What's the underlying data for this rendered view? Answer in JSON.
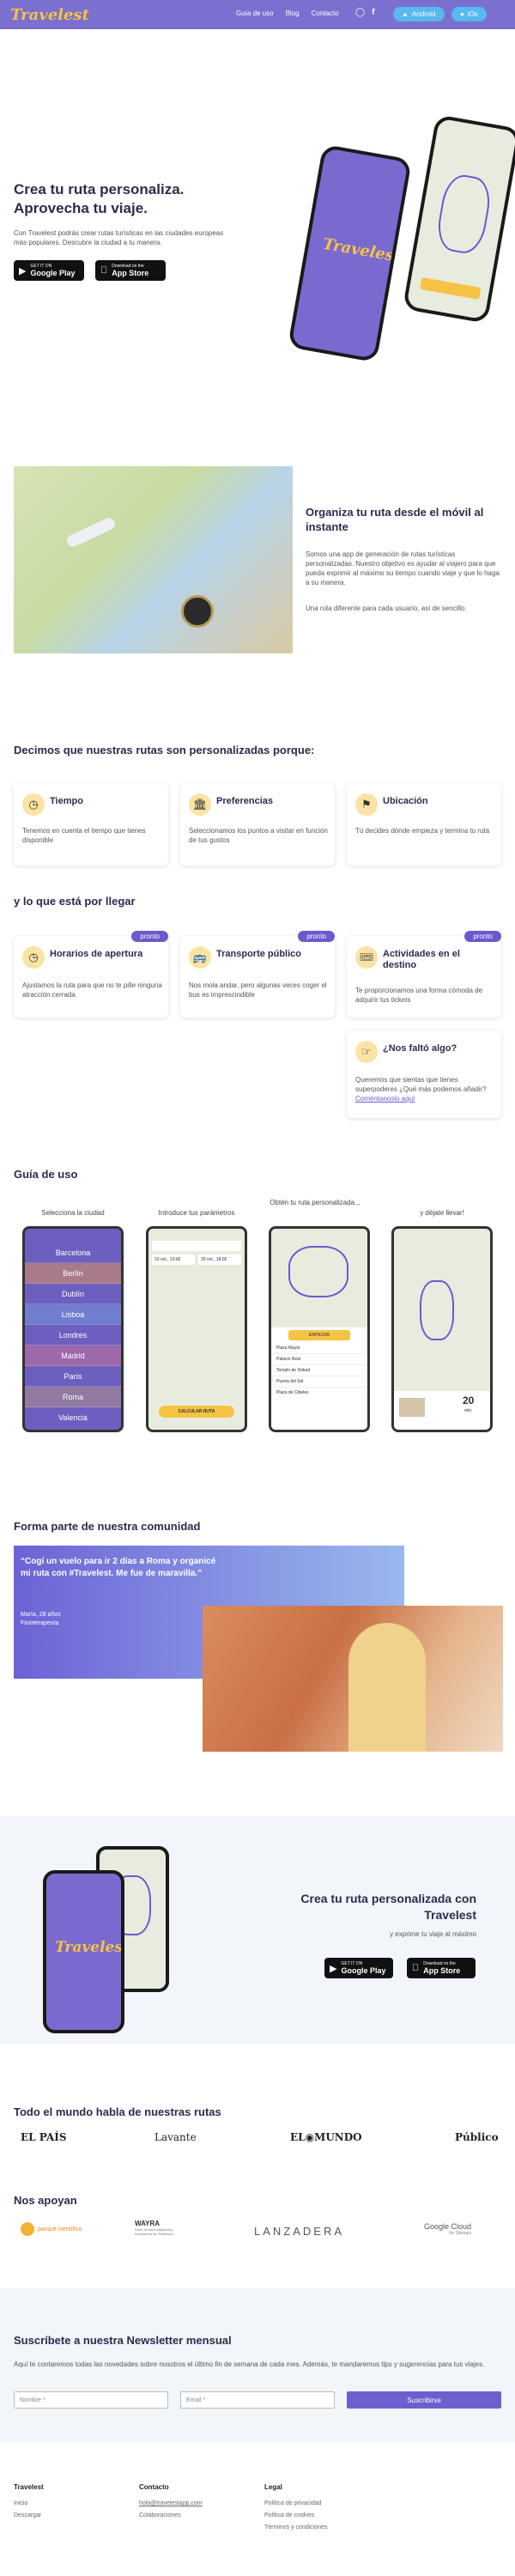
{
  "nav": {
    "logo": "Travelest",
    "links": [
      "Guía de uso",
      "Blog",
      "Contacto"
    ],
    "android": "Android",
    "ios": "iOs"
  },
  "hero": {
    "title": "Crea tu ruta personaliza. Aprovecha tu viaje.",
    "description": "Con Travelest podrás crear rutas turísticas en las ciudades europeas más populares. Descubre la ciudad a tu manera.",
    "google_small": "GET IT ON",
    "google_big": "Google Play",
    "apple_small": "Download on the",
    "apple_big": "App Store",
    "phone_logo": "Travelest"
  },
  "organize": {
    "title": "Organiza tu ruta desde el móvil al instante",
    "p1": "Somos una app de generación de rutas turísticas personalizadas. Nuestro objetivo es ayudar al viajero para que pueda exprimir al máximo su tiempo cuando viaje y que lo haga a su manera.",
    "p2": "Una ruta diferente para cada usuario, así de sencillo."
  },
  "features": {
    "title": "Decimos que nuestras rutas son personalizadas porque:",
    "cards": [
      {
        "title": "Tiempo",
        "text": "Tenemos en cuenta el tiempo que tienes disponible"
      },
      {
        "title": "Preferencias",
        "text": "Seleccionamos los puntos a visitar en función de tus gustos"
      },
      {
        "title": "Ubicación",
        "text": "Tú decides dónde empieza y termina tu ruta"
      }
    ]
  },
  "upcoming": {
    "title": "y lo que está por llegar",
    "badge": "pronto",
    "cards": [
      {
        "title": "Horarios de apertura",
        "text": "Ajustamos la ruta para que no te pille ninguna atracción cerrada"
      },
      {
        "title": "Transporte público",
        "text": "Nos mola andar, pero algunas veces coger el bus es imprescindible"
      },
      {
        "title": "Actividades en el destino",
        "text": "Te proporcionamos una forma cómoda de adquirir tus tickets"
      }
    ],
    "missing_title": "¿Nos faltó algo?",
    "missing_text": "Queremos que sientas que tienes superpoderes ¿Qué más podemos añadir?",
    "missing_link": "Coméntanoslo aquí"
  },
  "guide": {
    "title": "Guía de uso",
    "steps": [
      "Selecciona la ciudad",
      "Introduce tus parámetros",
      "Obtén tu ruta personalizada...",
      "y déjate llevar!"
    ],
    "cities": [
      "Barcelona",
      "Berlín",
      "Dublín",
      "Lisboa",
      "Londres",
      "Madrid",
      "París",
      "Roma",
      "Valencia"
    ],
    "form_from": "19 oct., 13:00",
    "form_to": "20 oct., 18:00",
    "form_button": "CALCULAR RUTA",
    "route_button": "EMPEZAR",
    "stops": [
      "Plaza Mayor",
      "Palacio Real",
      "Templo de Debod",
      "Puerta del Sol",
      "Plaza de Cibeles"
    ],
    "minutes_value": "20",
    "minutes_label": "min."
  },
  "community": {
    "title": "Forma parte de nuestra comunidad",
    "quote": "“Cogí un vuelo para ir 2 días a Roma y organicé mi ruta con #Travelest. Me fue de maravilla.”",
    "author_name": "María, 28 años",
    "author_job": "Fisioterapeuta"
  },
  "cta": {
    "title": "Crea tu ruta personalizada con Travelest",
    "subtitle": "y exprime tu viaje al máximo"
  },
  "press": {
    "title": "Todo el mundo habla de nuestras rutas",
    "logos": [
      "EL PAÍS",
      "Lavante",
      "EL◉MUNDO",
      "Público"
    ]
  },
  "sponsors": {
    "title": "Nos apoyan",
    "items": [
      "parque científico",
      "WAYRA",
      "LANZADERA",
      "Google Cloud"
    ],
    "wayra_sub": "Dolor sit amet adipiscing. Incubadora de Telefónica",
    "gcloud_sub": "for Startups"
  },
  "newsletter": {
    "title": "Suscríbete a nuestra Newsletter mensual",
    "text": "Aquí te contaremos todas las novedades sobre nosotros el último fin de semana de cada mes. Además, te mandaremos tips y sugerencias para tus viajes.",
    "name_placeholder": "Nombre *",
    "email_placeholder": "Email *",
    "button": "Suscribirse"
  },
  "footer": {
    "col1_title": "Travelest",
    "col1_links": [
      "Inicio",
      "Descargar"
    ],
    "col2_title": "Contacto",
    "col2_links": [
      "hola@travelestapp.com",
      "Colaboraciones"
    ],
    "col3_title": "Legal",
    "col3_links": [
      "Política de privacidad",
      "Política de cookies",
      "Términos y condiciones"
    ]
  },
  "colors": {
    "brand_purple": "#7b6fd0",
    "accent_yellow": "#f6c343",
    "pill_blue": "#58b8ef"
  }
}
